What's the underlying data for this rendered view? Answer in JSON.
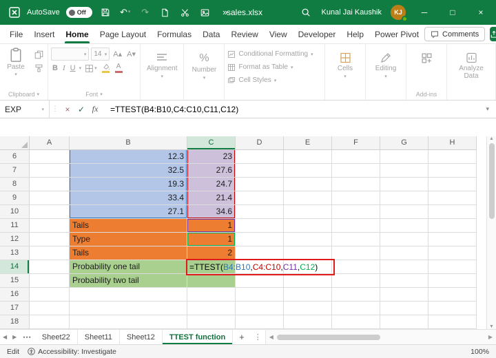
{
  "colors": {
    "brand_green": "#107c41",
    "fill_blue": "#b4c6e7",
    "fill_purple": "#ccc0da",
    "fill_orange": "#ed7d31",
    "fill_green": "#a9d08e",
    "annotation_red": "#e01a1a",
    "ref_blue": "#2e75b6",
    "ref_red": "#c00000",
    "ref_purple": "#7030a0",
    "ref_green": "#00b050",
    "avatar_orange": "#bc7e16"
  },
  "icons": {
    "dropdown": "▾",
    "undo": "↶",
    "redo": "↷",
    "more_chevrons": "»",
    "minimize": "─",
    "maximize": "□",
    "close": "×",
    "kebab": "⋮",
    "prev": "◀",
    "next": "▶",
    "up": "▲",
    "down": "▼",
    "tab_dots": "•••",
    "plus": "+",
    "cancel": "×",
    "enter": "✓",
    "font_increase": "A▴",
    "font_decrease": "A▾"
  },
  "title_bar": {
    "autosave_label": "AutoSave",
    "autosave_state": "Off",
    "file_name": "sales.xlsx",
    "user_name": "Kunal Jai Kaushik",
    "user_initials": "KJ"
  },
  "menu_bar": {
    "items": [
      "File",
      "Insert",
      "Home",
      "Page Layout",
      "Formulas",
      "Data",
      "Review",
      "View",
      "Developer",
      "Help",
      "Power Pivot"
    ],
    "active_item": "Home",
    "comments_label": "Comments"
  },
  "ribbon": {
    "paste_label": "Paste",
    "clipboard_group": "Clipboard",
    "font_group": "Font",
    "font_size_value": "14",
    "bold_label": "B",
    "italic_label": "I",
    "underline_label": "U",
    "alignment_label": "Alignment",
    "number_label": "Number",
    "percent_symbol": "%",
    "styles_items": [
      "Conditional Formatting",
      "Format as Table",
      "Cell Styles"
    ],
    "cells_label": "Cells",
    "editing_label": "Editing",
    "addins_label": "Add-ins",
    "analyze_data_label": "Analyze Data"
  },
  "formula_bar": {
    "name_box_value": "EXP",
    "fx_label": "fx",
    "formula_text": "=TTEST(B4:B10,C4:C10,C11,C12)"
  },
  "grid": {
    "column_headers": [
      "A",
      "B",
      "C",
      "D",
      "E",
      "F",
      "G",
      "H"
    ],
    "selected_column": "C",
    "selected_row": 14,
    "cell_formula_segments": [
      {
        "text": "=TTEST(",
        "color": "#000000"
      },
      {
        "text": "B4:B10",
        "color": "#2e75b6"
      },
      {
        "text": ",",
        "color": "#000000"
      },
      {
        "text": "C4:C10",
        "color": "#c00000"
      },
      {
        "text": ",",
        "color": "#000000"
      },
      {
        "text": "C11",
        "color": "#7030a0"
      },
      {
        "text": ",",
        "color": "#000000"
      },
      {
        "text": "C12",
        "color": "#00b050"
      },
      {
        "text": ")",
        "color": "#000000"
      }
    ],
    "rows": [
      {
        "n": "6",
        "cells": {
          "B": {
            "v": "12.3",
            "fill": "blue",
            "align": "right",
            "ref": "blue",
            "ref_edges": "lr"
          },
          "C": {
            "v": "23",
            "fill": "purple",
            "align": "right",
            "ref": "red",
            "ref_edges": "lr"
          }
        }
      },
      {
        "n": "7",
        "cells": {
          "B": {
            "v": "32.5",
            "fill": "blue",
            "align": "right",
            "ref": "blue",
            "ref_edges": "lr"
          },
          "C": {
            "v": "27.6",
            "fill": "purple",
            "align": "right",
            "ref": "red",
            "ref_edges": "lr"
          }
        }
      },
      {
        "n": "8",
        "cells": {
          "B": {
            "v": "19.3",
            "fill": "blue",
            "align": "right",
            "ref": "blue",
            "ref_edges": "lr"
          },
          "C": {
            "v": "24.7",
            "fill": "purple",
            "align": "right",
            "ref": "red",
            "ref_edges": "lr"
          }
        }
      },
      {
        "n": "9",
        "cells": {
          "B": {
            "v": "33.4",
            "fill": "blue",
            "align": "right",
            "ref": "blue",
            "ref_edges": "lr"
          },
          "C": {
            "v": "21.4",
            "fill": "purple",
            "align": "right",
            "ref": "red",
            "ref_edges": "lr"
          }
        }
      },
      {
        "n": "10",
        "cells": {
          "B": {
            "v": "27.1",
            "fill": "blue",
            "align": "right",
            "ref": "blue",
            "ref_edges": "lrb"
          },
          "C": {
            "v": "34.6",
            "fill": "purple",
            "align": "right",
            "ref": "red",
            "ref_edges": "lrb"
          }
        }
      },
      {
        "n": "11",
        "cells": {
          "B": {
            "v": "Tails",
            "fill": "orange"
          },
          "C": {
            "v": "1",
            "fill": "orange",
            "align": "right",
            "ref": "purple",
            "ref_edges": "lrtb"
          }
        }
      },
      {
        "n": "12",
        "cells": {
          "B": {
            "v": "Type",
            "fill": "orange"
          },
          "C": {
            "v": "1",
            "fill": "orange",
            "align": "right",
            "ref": "green",
            "ref_edges": "lrtb"
          }
        }
      },
      {
        "n": "13",
        "cells": {
          "B": {
            "v": "Tails",
            "fill": "orange"
          },
          "C": {
            "v": "2",
            "fill": "orange",
            "align": "right"
          }
        }
      },
      {
        "n": "14",
        "cells": {
          "B": {
            "v": "Probability one tail",
            "fill": "green"
          },
          "C": {
            "formula": true,
            "fill": "green"
          }
        }
      },
      {
        "n": "15",
        "cells": {
          "B": {
            "v": "Probability two tail",
            "fill": "green"
          },
          "C": {
            "v": "",
            "fill": "green"
          }
        }
      },
      {
        "n": "16",
        "cells": {}
      },
      {
        "n": "17",
        "cells": {}
      },
      {
        "n": "18",
        "cells": {}
      }
    ]
  },
  "sheet_tabs": {
    "tabs": [
      "Sheet22",
      "Sheet11",
      "Sheet12",
      "TTEST function"
    ],
    "active_tab": "TTEST function"
  },
  "status_bar": {
    "mode": "Edit",
    "accessibility": "Accessibility: Investigate",
    "zoom": "100%"
  }
}
